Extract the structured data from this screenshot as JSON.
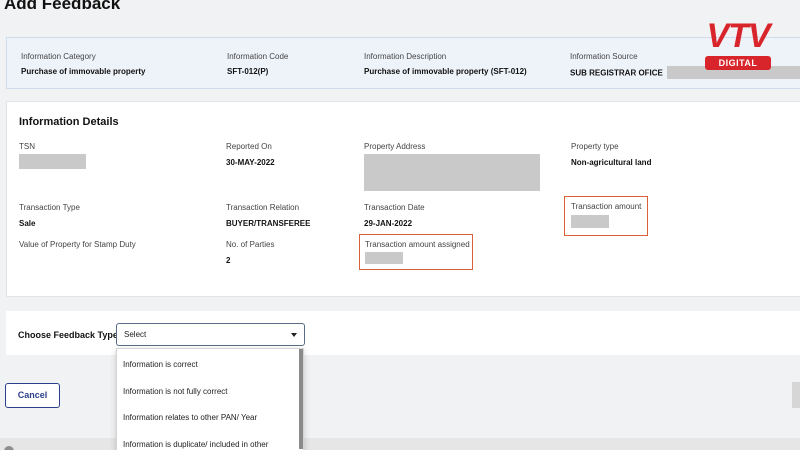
{
  "page_title": "Add Feedback",
  "banner": {
    "category_label": "Information Category",
    "category_value": "Purchase of immovable property",
    "code_label": "Information Code",
    "code_value": "SFT-012(P)",
    "description_label": "Information Description",
    "description_value": "Purchase of immovable property (SFT-012)",
    "source_label": "Information Source",
    "source_value": "SUB REGISTRAR OFICE"
  },
  "details": {
    "title": "Information Details",
    "tsn_label": "TSN",
    "reported_on_label": "Reported On",
    "reported_on_value": "30-MAY-2022",
    "property_address_label": "Property Address",
    "property_type_label": "Property type",
    "property_type_value": "Non-agricultural land",
    "transaction_type_label": "Transaction Type",
    "transaction_type_value": "Sale",
    "transaction_relation_label": "Transaction Relation",
    "transaction_relation_value": "BUYER/TRANSFEREE",
    "transaction_date_label": "Transaction Date",
    "transaction_date_value": "29-JAN-2022",
    "transaction_amount_label": "Transaction amount",
    "stamp_duty_label": "Value of Property for Stamp Duty",
    "parties_label": "No. of Parties",
    "parties_value": "2",
    "amount_assigned_label": "Transaction amount assigned"
  },
  "feedback": {
    "label": "Choose Feedback Type:",
    "selected": "Select",
    "options": [
      "Information is correct",
      "Information is not fully correct",
      "Information relates to other PAN/ Year",
      "Information is duplicate/ included in other"
    ]
  },
  "actions": {
    "cancel_label": "Cancel"
  },
  "logo": {
    "word": "VTV",
    "badge": "DIGITAL"
  },
  "colors": {
    "accent_red": "#d8242b",
    "highlight_border": "#d9603b",
    "button_blue": "#2c3f8c",
    "banner_bg": "#eef3fa"
  }
}
